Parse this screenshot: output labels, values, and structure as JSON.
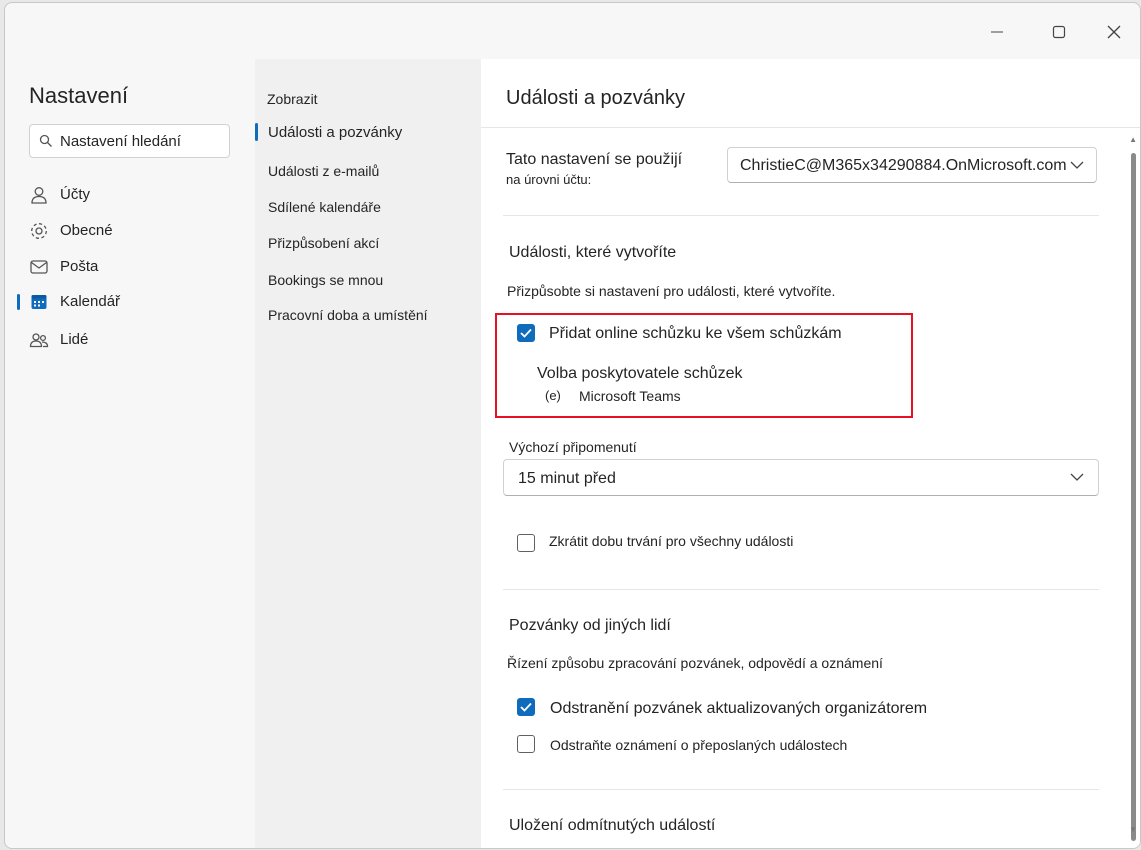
{
  "window": {
    "controls": {
      "minimize": "minimize",
      "maximize": "maximize",
      "close": "close"
    }
  },
  "left": {
    "title": "Nastavení",
    "search": {
      "placeholder": "Nastavení hledání"
    },
    "nav": [
      {
        "label": "Účty",
        "icon": "person-icon"
      },
      {
        "label": "Obecné",
        "icon": "gear-icon"
      },
      {
        "label": "Pošta",
        "icon": "mail-icon"
      },
      {
        "label": "Kalendář",
        "icon": "calendar-icon",
        "selected": true
      },
      {
        "label": "Lidé",
        "icon": "people-icon"
      }
    ]
  },
  "middle": {
    "heading": "Zobrazit",
    "items": [
      {
        "label": "Události a pozvánky",
        "selected": true
      },
      {
        "label": "Události z e-mailů"
      },
      {
        "label": "Sdílené kalendáře"
      },
      {
        "label": "Přizpůsobení akcí"
      },
      {
        "label": "Bookings se mnou"
      },
      {
        "label": "Pracovní doba a umístění"
      }
    ]
  },
  "right": {
    "title": "Události a pozvánky",
    "apply_label_line1": "Tato nastavení se použijí",
    "apply_label_line2": "na úrovni účtu:",
    "account": "ChristieC@M365x34290884.OnMicrosoft.com",
    "events_created": {
      "heading": "Události, které vytvoříte",
      "description": "Přizpůsobte si nastavení pro události, které vytvoříte.",
      "add_online_meeting": {
        "label": "Přidat online schůzku ke všem schůzkám",
        "checked": true
      },
      "provider_label": "Volba poskytovatele schůzek",
      "provider_marker": "(e)",
      "provider_value": "Microsoft Teams",
      "reminder_label": "Výchozí připomenutí",
      "reminder_value": "15 minut před",
      "shorten_duration": {
        "label": "Zkrátit dobu trvání pro všechny události",
        "checked": false
      }
    },
    "invitations": {
      "heading": "Pozvánky od jiných lidí",
      "description": "Řízení způsobu zpracování pozvánek, odpovědí a oznámení",
      "delete_updated": {
        "label": "Odstranění pozvánek aktualizovaných organizátorem",
        "checked": true
      },
      "delete_forwarded": {
        "label": "Odstraňte oznámení o přeposlaných událostech",
        "checked": false
      }
    },
    "declined": {
      "heading": "Uložení odmítnutých událostí"
    }
  },
  "colors": {
    "accent": "#0f6cbd",
    "highlight": "#e81123"
  }
}
